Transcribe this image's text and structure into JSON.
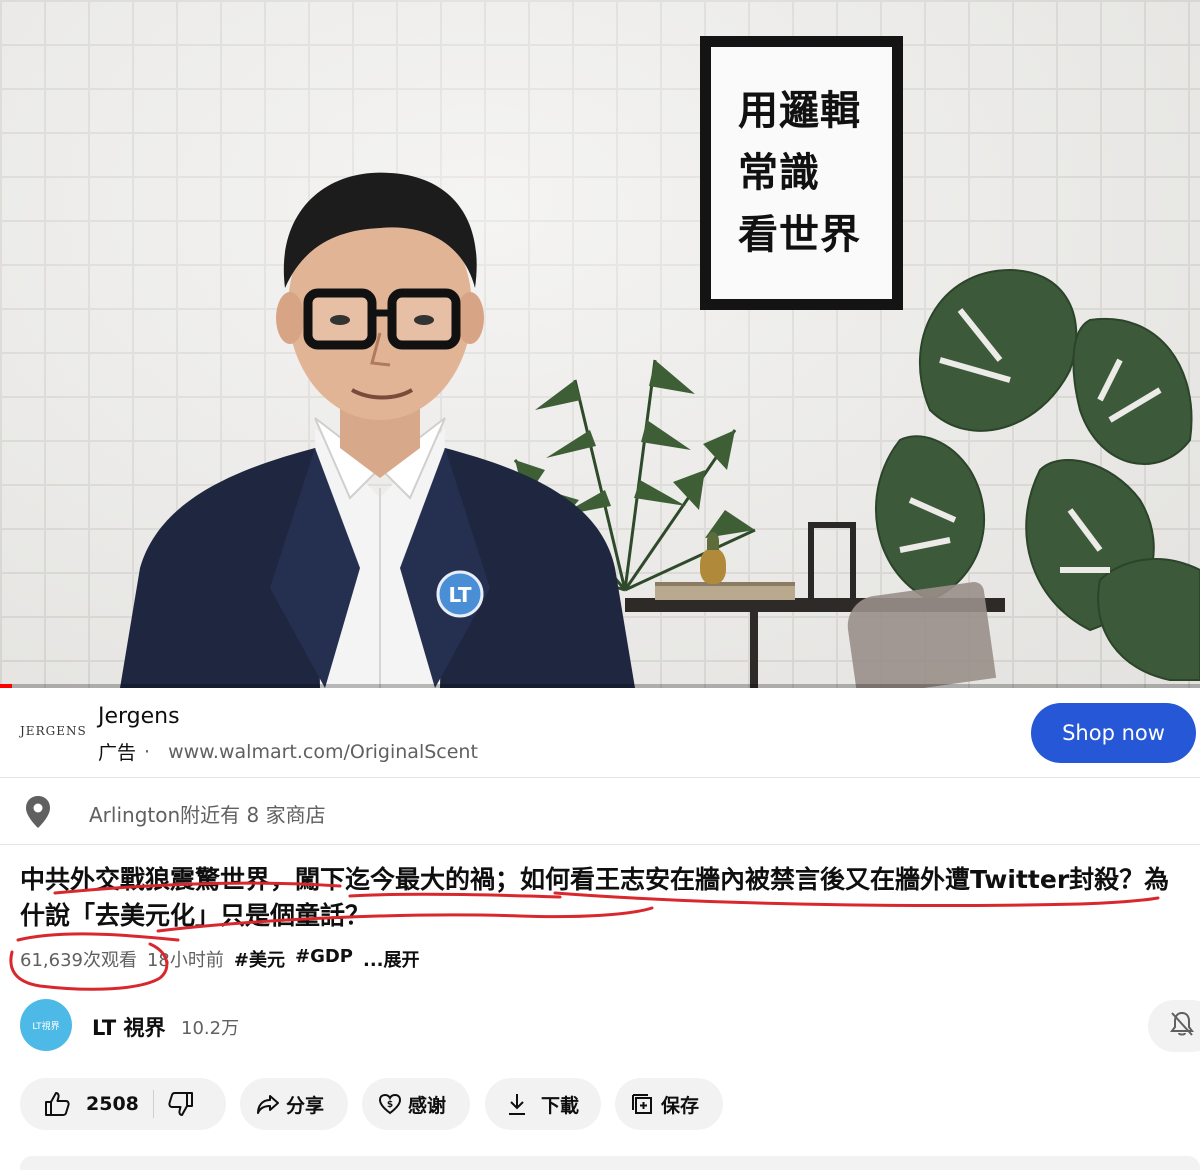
{
  "video": {
    "poster_lines": [
      "用邏輯",
      "常識",
      "看世界"
    ],
    "badge": "LT",
    "progress_fraction": 0.01
  },
  "ad": {
    "logo_text": "JERGENS",
    "brand": "Jergens",
    "label": "广告",
    "separator": "·",
    "url": "www.walmart.com/OriginalScent",
    "cta": "Shop now",
    "cta_color": "#2557d6"
  },
  "location": {
    "text": "Arlington附近有 8 家商店"
  },
  "video_info": {
    "title": "中共外交戰狼震驚世界，闖下迄今最大的禍；如何看王志安在牆內被禁言後又在牆外遭Twitter封殺？為什說「去美元化」只是個童話？",
    "views": "61,639次观看",
    "age": "18小时前",
    "tags": [
      "#美元",
      "#GDP"
    ],
    "more": "...展开"
  },
  "channel": {
    "avatar_text": "LT視界",
    "name": "LT 視界",
    "subscribers": "10.2万"
  },
  "actions": {
    "likes": "2508",
    "share": "分享",
    "thanks": "感谢",
    "download": "下載",
    "save": "保存"
  },
  "colors": {
    "annotation": "#d9272e",
    "progress": "#ff0000"
  }
}
